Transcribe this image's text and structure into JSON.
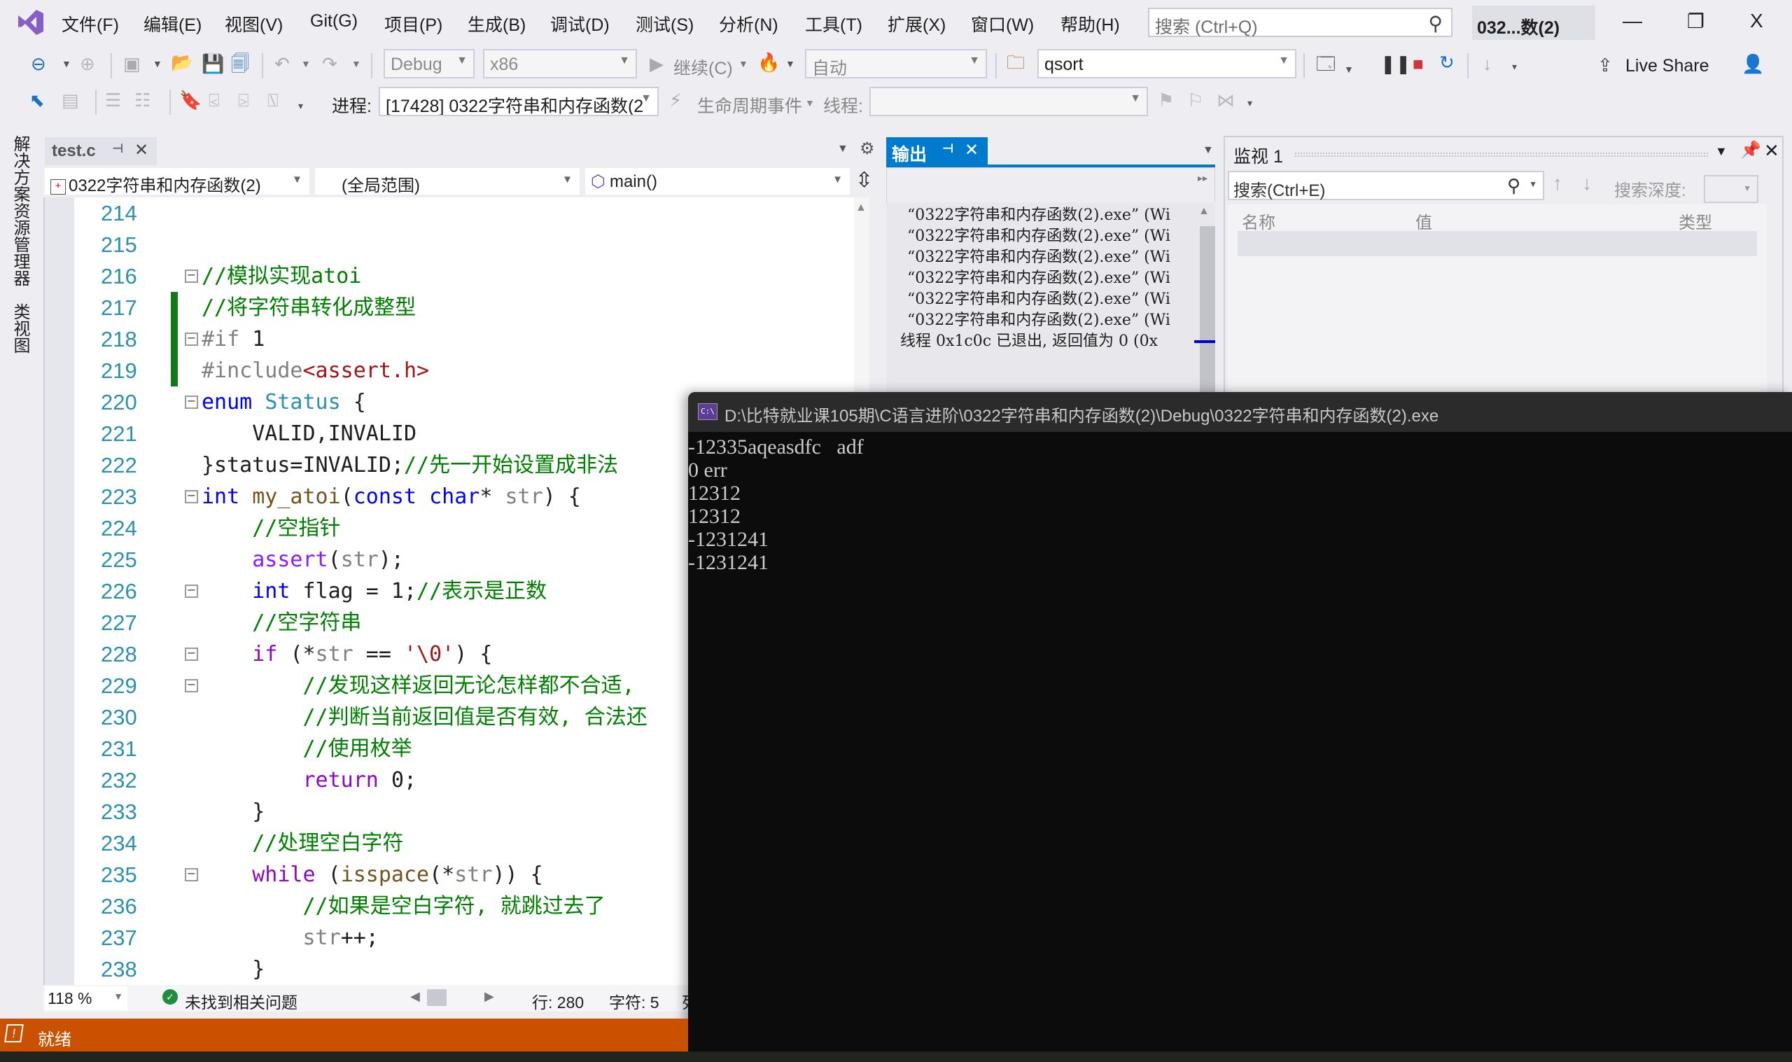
{
  "menubar": {
    "items": [
      "文件(F)",
      "编辑(E)",
      "视图(V)",
      "Git(G)",
      "项目(P)",
      "生成(B)",
      "调试(D)",
      "测试(S)",
      "分析(N)",
      "工具(T)",
      "扩展(X)",
      "窗口(W)",
      "帮助(H)"
    ],
    "search_placeholder": "搜索 (Ctrl+Q)",
    "project_title": "032...数(2)",
    "minimize": "—",
    "restore": "❐",
    "close": "X"
  },
  "toolbar1": {
    "config": "Debug",
    "platform": "x86",
    "continue_label": "继续(C)",
    "auto_combo": "自动",
    "find_combo": "qsort",
    "live_share": "Live Share"
  },
  "toolbar2": {
    "process_label": "进程:",
    "process_value": "[17428] 0322字符串和内存函数(2",
    "lifecycle_label": "生命周期事件",
    "thread_label": "线程:",
    "thread_value": ""
  },
  "sidebar": {
    "tabs": [
      "解决方案资源管理器",
      "类视图"
    ]
  },
  "editor": {
    "tab_name": "test.c",
    "project_combo": "0322字符串和内存函数(2)",
    "scope_combo": "(全局范围)",
    "member_combo": "main()",
    "zoom": "118 %",
    "issues": "未找到相关问题",
    "line_info": "行: 280",
    "char_info": "字符: 5",
    "col_info_partial": "列",
    "lines": [
      {
        "n": "214",
        "tokens": []
      },
      {
        "n": "215",
        "tokens": []
      },
      {
        "n": "216",
        "fold": true,
        "tokens": [
          {
            "c": "com",
            "t": "//模拟实现atoi"
          }
        ]
      },
      {
        "n": "217",
        "changed": true,
        "tokens": [
          {
            "c": "com",
            "t": "//将字符串转化成整型"
          }
        ]
      },
      {
        "n": "218",
        "changed": true,
        "fold": true,
        "tokens": [
          {
            "c": "pp",
            "t": "#if "
          },
          {
            "c": "",
            "t": "1"
          }
        ]
      },
      {
        "n": "219",
        "changed": true,
        "tokens": [
          {
            "c": "pp",
            "t": "#include"
          },
          {
            "c": "str",
            "t": "<assert.h>"
          }
        ]
      },
      {
        "n": "220",
        "fold": true,
        "tokens": [
          {
            "c": "kw",
            "t": "enum "
          },
          {
            "c": "type",
            "t": "Status"
          },
          {
            "c": "",
            "t": " {"
          }
        ]
      },
      {
        "n": "221",
        "tokens": [
          {
            "c": "",
            "t": "    VALID,INVALID"
          }
        ]
      },
      {
        "n": "222",
        "tokens": [
          {
            "c": "",
            "t": "}status=INVALID;"
          },
          {
            "c": "com",
            "t": "//先一开始设置成非法"
          }
        ]
      },
      {
        "n": "223",
        "fold": true,
        "tokens": [
          {
            "c": "kw",
            "t": "int "
          },
          {
            "c": "fn",
            "t": "my_atoi"
          },
          {
            "c": "",
            "t": "("
          },
          {
            "c": "kw",
            "t": "const char"
          },
          {
            "c": "",
            "t": "* "
          },
          {
            "c": "par",
            "t": "str"
          },
          {
            "c": "",
            "t": ") {"
          }
        ]
      },
      {
        "n": "224",
        "tokens": [
          {
            "c": "com",
            "t": "    //空指针"
          }
        ]
      },
      {
        "n": "225",
        "tokens": [
          {
            "c": "mac",
            "t": "    assert"
          },
          {
            "c": "",
            "t": "("
          },
          {
            "c": "par",
            "t": "str"
          },
          {
            "c": "",
            "t": ");"
          }
        ]
      },
      {
        "n": "226",
        "fold": true,
        "tokens": [
          {
            "c": "kw",
            "t": "    int "
          },
          {
            "c": "",
            "t": "flag = 1;"
          },
          {
            "c": "com",
            "t": "//表示是正数"
          }
        ]
      },
      {
        "n": "227",
        "tokens": [
          {
            "c": "com",
            "t": "    //空字符串"
          }
        ]
      },
      {
        "n": "228",
        "fold": true,
        "tokens": [
          {
            "c": "ctl",
            "t": "    if "
          },
          {
            "c": "",
            "t": "(*"
          },
          {
            "c": "par",
            "t": "str"
          },
          {
            "c": "",
            "t": " == "
          },
          {
            "c": "chr",
            "t": "'\\0'"
          },
          {
            "c": "",
            "t": ") {"
          }
        ]
      },
      {
        "n": "229",
        "fold": true,
        "tokens": [
          {
            "c": "com",
            "t": "        //发现这样返回无论怎样都不合适,"
          }
        ]
      },
      {
        "n": "230",
        "tokens": [
          {
            "c": "com",
            "t": "        //判断当前返回值是否有效, 合法还"
          }
        ]
      },
      {
        "n": "231",
        "tokens": [
          {
            "c": "com",
            "t": "        //使用枚举"
          }
        ]
      },
      {
        "n": "232",
        "tokens": [
          {
            "c": "ctl",
            "t": "        return "
          },
          {
            "c": "",
            "t": "0;"
          }
        ]
      },
      {
        "n": "233",
        "tokens": [
          {
            "c": "",
            "t": "    }"
          }
        ]
      },
      {
        "n": "234",
        "tokens": [
          {
            "c": "com",
            "t": "    //处理空白字符"
          }
        ]
      },
      {
        "n": "235",
        "fold": true,
        "tokens": [
          {
            "c": "ctl",
            "t": "    while "
          },
          {
            "c": "",
            "t": "("
          },
          {
            "c": "fn",
            "t": "isspace"
          },
          {
            "c": "",
            "t": "(*"
          },
          {
            "c": "par",
            "t": "str"
          },
          {
            "c": "",
            "t": ")) {"
          }
        ]
      },
      {
        "n": "236",
        "tokens": [
          {
            "c": "com",
            "t": "        //如果是空白字符, 就跳过去了"
          }
        ]
      },
      {
        "n": "237",
        "tokens": [
          {
            "c": "par",
            "t": "        str"
          },
          {
            "c": "",
            "t": "++;"
          }
        ]
      },
      {
        "n": "238",
        "tokens": [
          {
            "c": "",
            "t": "    }"
          }
        ]
      }
    ]
  },
  "output": {
    "tab_label": "输出",
    "lines": [
      "“0322字符串和内存函数(2).exe” (Wi",
      "“0322字符串和内存函数(2).exe” (Wi",
      "“0322字符串和内存函数(2).exe” (Wi",
      "“0322字符串和内存函数(2).exe” (Wi",
      "“0322字符串和内存函数(2).exe” (Wi",
      "“0322字符串和内存函数(2).exe” (Wi",
      "线程 0x1c0c 已退出, 返回值为 0 (0x"
    ]
  },
  "watch": {
    "title": "监视 1",
    "search_placeholder": "搜索(Ctrl+E)",
    "depth_label": "搜索深度:",
    "columns": [
      "名称",
      "值",
      "类型"
    ]
  },
  "console": {
    "title": "D:\\比特就业课105期\\C语言进阶\\0322字符串和内存函数(2)\\Debug\\0322字符串和内存函数(2).exe",
    "icon_text": "C:\\",
    "lines": [
      "-12335aqeasdfc   adf",
      "0 err",
      "12312",
      "12312",
      "-1231241",
      "-1231241"
    ]
  },
  "statusbar": {
    "text": "就绪"
  },
  "colors": {
    "accent": "#007acc",
    "status_debug": "#ca5100",
    "vs_purple": "#865fc5",
    "change_marker": "#117a17"
  }
}
